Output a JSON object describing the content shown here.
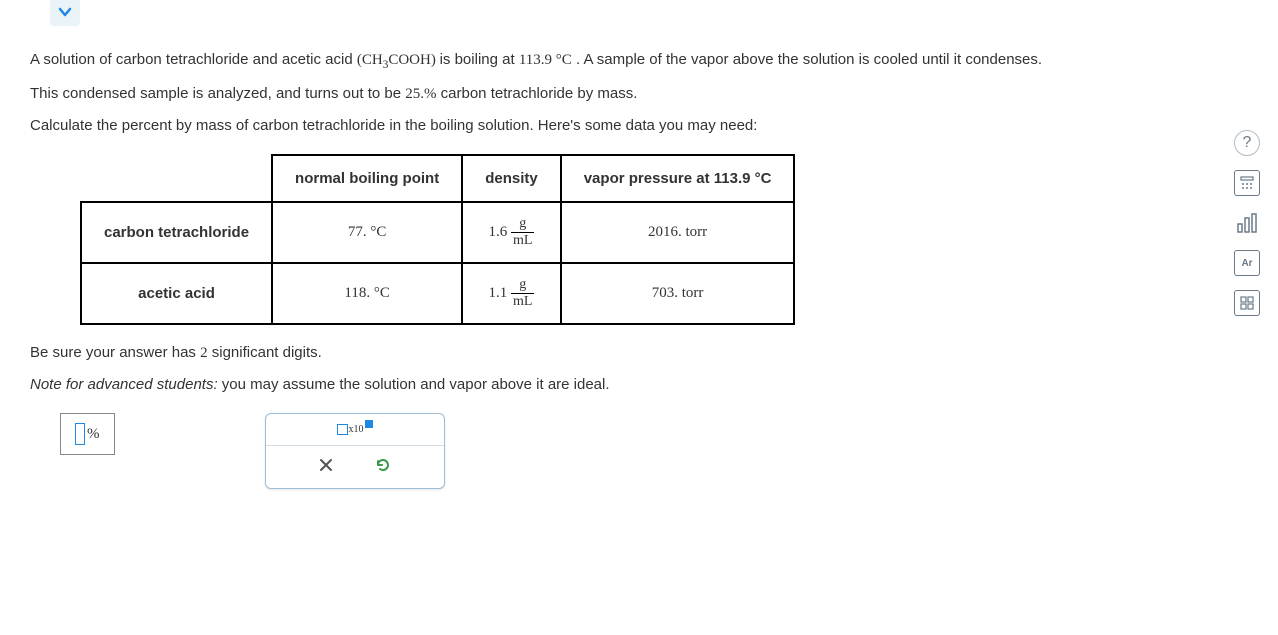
{
  "problem": {
    "line1_a": "A solution of carbon tetrachloride and acetic acid ",
    "formula_pre": "(CH",
    "formula_sub": "3",
    "formula_post": "COOH)",
    "line1_b": " is boiling at ",
    "temp": "113.9 °C",
    "line1_c": ". A sample of the vapor above the solution is cooled until it condenses.",
    "line2_a": "This condensed sample is analyzed, and turns out to be ",
    "percent": "25.%",
    "line2_b": " carbon tetrachloride by mass.",
    "line3": "Calculate the percent by mass of carbon tetrachloride in the boiling solution. Here's some data you may need:"
  },
  "table": {
    "h1": "normal boiling point",
    "h2": "density",
    "h3": "vapor pressure at 113.9 °C",
    "rows": [
      {
        "name": "carbon tetrachloride",
        "bp": "77. °C",
        "d_val": "1.6",
        "d_top": "g",
        "d_bot": "mL",
        "vp": "2016. torr"
      },
      {
        "name": "acetic acid",
        "bp": "118. °C",
        "d_val": "1.1",
        "d_top": "g",
        "d_bot": "mL",
        "vp": "703. torr"
      }
    ]
  },
  "instructions": {
    "sigfig_a": "Be sure your answer has ",
    "sigfig_num": "2",
    "sigfig_b": " significant digits.",
    "note_label": "Note for advanced students:",
    "note_text": " you may assume the solution and vapor above it are ideal."
  },
  "answer": {
    "unit": "%"
  },
  "tools": {
    "sci_x10": "x10"
  },
  "side": {
    "help": "?",
    "periodic": "Ar"
  }
}
